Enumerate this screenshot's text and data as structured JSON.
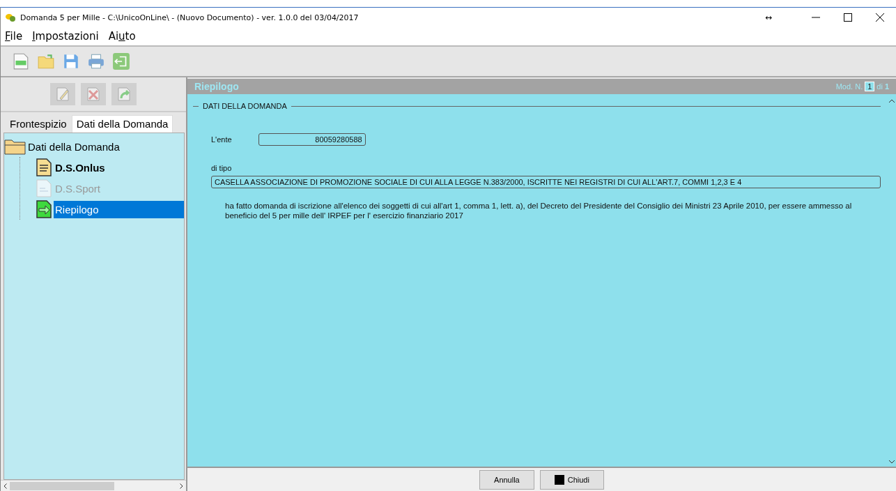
{
  "window": {
    "title": "Domanda 5 per Mille - C:\\UnicoOnLine\\ - (Nuovo Documento)  -  ver. 1.0.0 del 03/04/2017",
    "resize_glyph": "↔"
  },
  "menu": [
    {
      "key": "F",
      "after": "ile"
    },
    {
      "key": "I",
      "after": "mpostazioni"
    },
    {
      "before": "Ai",
      "key": "u",
      "after": "to"
    }
  ],
  "tabs": [
    {
      "label": "Frontespizio",
      "selected": false
    },
    {
      "label": "Dati della Domanda",
      "selected": true
    }
  ],
  "tree": {
    "label": "Dati della Domanda",
    "children": [
      {
        "label": "D.S.Onlus",
        "kind": "doc",
        "disabled": false,
        "selected": false
      },
      {
        "label": "D.S.Sport",
        "kind": "doc",
        "disabled": true,
        "selected": false
      },
      {
        "label": "Riepilogo",
        "kind": "arrow",
        "disabled": false,
        "selected": true
      }
    ]
  },
  "panel": {
    "title": "Riepilogo",
    "mod_label": "Mod. N.",
    "mod_value": "1",
    "of_label": "di",
    "of_value": "1",
    "section": "DATI DELLA DOMANDA",
    "ente_label": "L'ente",
    "ente_value": "80059280588",
    "tipo_label": "di tipo",
    "tipo_value": "CASELLA ASSOCIAZIONE DI PROMOZIONE SOCIALE DI CUI ALLA LEGGE N.383/2000, ISCRITTE NEI REGISTRI DI CUI ALL'ART.7, COMMI 1,2,3 E 4",
    "statement": "ha fatto domanda di iscrizione all'elenco dei soggetti di cui all'art 1, comma 1, lett. a), del Decreto del Presidente del Consiglio dei Ministri 23 Aprile 2010, per essere ammesso al beneficio del 5 per mille dell' IRPEF per l' esercizio finanziario 2017"
  },
  "buttons": [
    "Annulla",
    "Chiudi"
  ]
}
